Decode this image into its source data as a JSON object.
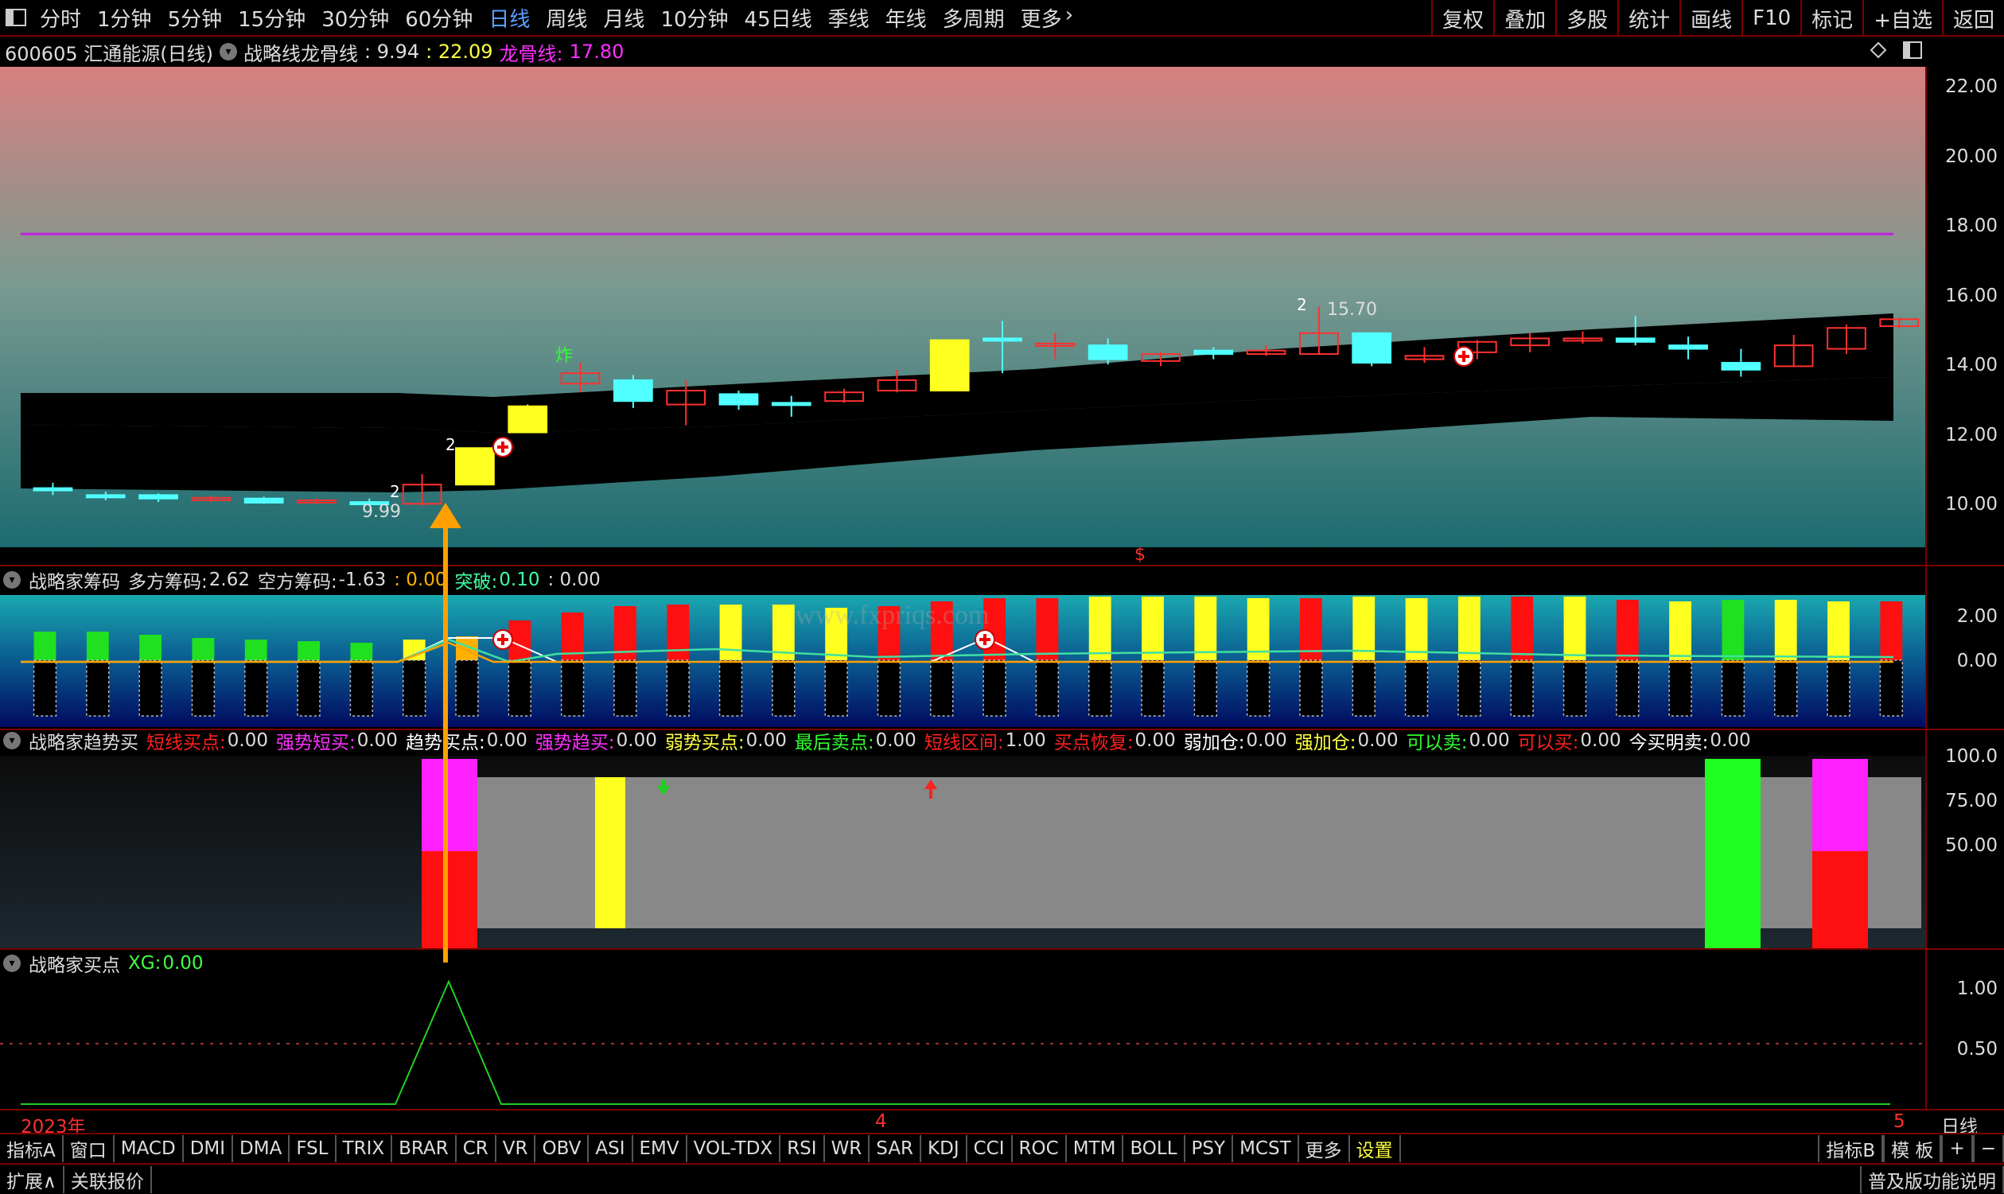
{
  "topbar": {
    "periods": [
      "分时",
      "1分钟",
      "5分钟",
      "15分钟",
      "30分钟",
      "60分钟",
      "日线",
      "周线",
      "月线",
      "10分钟",
      "45日线",
      "季线",
      "年线",
      "多周期",
      "更多"
    ],
    "active_index": 6,
    "right_tools": [
      "复权",
      "叠加",
      "多股",
      "统计",
      "画线",
      "F10",
      "标记",
      "+自选",
      "返回"
    ]
  },
  "main": {
    "stock": "600605 汇通能源(日线)",
    "indicator": "战略线龙骨线",
    "v1": ": 9.94",
    "v2": ": 22.09",
    "dragon_label": "龙骨线:",
    "dragon_value": "17.80",
    "axis": [
      "22.00",
      "20.00",
      "18.00",
      "16.00",
      "14.00",
      "12.00",
      "10.00"
    ],
    "annot_high": "15.70",
    "annot_low": "9.99",
    "annot_zha": "炸",
    "annot_2a": "2",
    "annot_2b": "2",
    "annot_2c": "2",
    "marker_s": "$"
  },
  "chip": {
    "name": "战略家筹码",
    "multi_label": "多方筹码:",
    "multi_value": "2.62",
    "empty_label": "空方筹码:",
    "empty_value": "-1.63",
    "zero_value": ": 0.00",
    "break_label": "突破:",
    "break_value": "0.10",
    "tail": ": 0.00",
    "axis": [
      "2.00",
      "0.00"
    ],
    "watermark": "www.fxpriqs.com"
  },
  "trend": {
    "name": "战略家趋势买",
    "items": [
      {
        "label": "短线买点:",
        "value": "0.00",
        "color": "#ff2020"
      },
      {
        "label": "强势短买:",
        "value": "0.00",
        "color": "#ff30ff"
      },
      {
        "label": "趋势买点:",
        "value": "0.00",
        "color": "#ffffff"
      },
      {
        "label": "强势趋买:",
        "value": "0.00",
        "color": "#ff30ff"
      },
      {
        "label": "弱势买点:",
        "value": "0.00",
        "color": "#ffff40"
      },
      {
        "label": "最后卖点:",
        "value": "0.00",
        "color": "#30ff30"
      },
      {
        "label": "短线区间:",
        "value": "1.00",
        "color": "#ff2020"
      },
      {
        "label": "买点恢复:",
        "value": "0.00",
        "color": "#ff2020"
      },
      {
        "label": "弱加仓:",
        "value": "0.00",
        "color": "#ffffff"
      },
      {
        "label": "强加仓:",
        "value": "0.00",
        "color": "#ffff40"
      },
      {
        "label": "可以卖:",
        "value": "0.00",
        "color": "#30ff30"
      },
      {
        "label": "可以买:",
        "value": "0.00",
        "color": "#ff2020"
      },
      {
        "label": "今买明卖:",
        "value": "0.00",
        "color": "#ffffff"
      }
    ],
    "axis": [
      "100.0",
      "75.00",
      "50.00"
    ]
  },
  "buy": {
    "name": "战略家买点",
    "xg_label": "XG:",
    "xg_value": "0.00",
    "axis": [
      "1.00",
      "0.50"
    ]
  },
  "timeline": {
    "year": "2023年",
    "m4": "4",
    "m5": "5",
    "period": "日线"
  },
  "bottom_tabs": [
    "指标A",
    "窗口",
    "MACD",
    "DMI",
    "DMA",
    "FSL",
    "TRIX",
    "BRAR",
    "CR",
    "VR",
    "OBV",
    "ASI",
    "EMV",
    "VOL-TDX",
    "RSI",
    "WR",
    "SAR",
    "KDJ",
    "CCI",
    "ROC",
    "MTM",
    "BOLL",
    "PSY",
    "MCST",
    "更多",
    "设置"
  ],
  "bottom_right": [
    "指标B",
    "模 板",
    "+",
    "−"
  ],
  "foot": {
    "left1": "扩展∧",
    "left2": "关联报价",
    "right": "普及版功能说明"
  },
  "chart_data": {
    "type": "candlestick",
    "ylim": [
      8.8,
      22.6
    ],
    "candles": [
      {
        "o": 10.5,
        "c": 10.5,
        "h": 10.65,
        "l": 10.3,
        "col": "#50ffff"
      },
      {
        "o": 10.3,
        "c": 10.25,
        "h": 10.4,
        "l": 10.15,
        "col": "#50ffff"
      },
      {
        "o": 10.3,
        "c": 10.2,
        "h": 10.35,
        "l": 10.1,
        "col": "#50ffff"
      },
      {
        "o": 10.18,
        "c": 10.22,
        "h": 10.28,
        "l": 10.1,
        "col": "#ff3030"
      },
      {
        "o": 10.2,
        "c": 10.08,
        "h": 10.25,
        "l": 10.05,
        "col": "#50ffff"
      },
      {
        "o": 10.12,
        "c": 10.15,
        "h": 10.2,
        "l": 10.05,
        "col": "#ff3030"
      },
      {
        "o": 10.1,
        "c": 10.05,
        "h": 10.2,
        "l": 9.99,
        "col": "#50ffff"
      },
      {
        "o": 10.05,
        "c": 10.6,
        "h": 10.9,
        "l": 9.99,
        "col": "#ff3030"
      },
      {
        "o": 10.6,
        "c": 11.65,
        "h": 11.65,
        "l": 10.6,
        "col": "#ffff20"
      },
      {
        "o": 12.1,
        "c": 12.85,
        "h": 12.9,
        "l": 12.1,
        "col": "#ffff20"
      },
      {
        "o": 13.5,
        "c": 13.8,
        "h": 14.1,
        "l": 13.25,
        "col": "#ff3030"
      },
      {
        "o": 13.6,
        "c": 13.0,
        "h": 13.75,
        "l": 12.8,
        "col": "#50ffff"
      },
      {
        "o": 12.9,
        "c": 13.3,
        "h": 13.6,
        "l": 12.3,
        "col": "#ff3030"
      },
      {
        "o": 13.2,
        "c": 12.9,
        "h": 13.3,
        "l": 12.75,
        "col": "#50ffff"
      },
      {
        "o": 12.95,
        "c": 12.9,
        "h": 13.15,
        "l": 12.55,
        "col": "#50ffff"
      },
      {
        "o": 13.0,
        "c": 13.25,
        "h": 13.35,
        "l": 12.95,
        "col": "#ff3030"
      },
      {
        "o": 13.3,
        "c": 13.6,
        "h": 13.9,
        "l": 13.25,
        "col": "#ff3030"
      },
      {
        "o": 13.3,
        "c": 14.75,
        "h": 14.75,
        "l": 13.3,
        "col": "#ffff20"
      },
      {
        "o": 14.8,
        "c": 14.75,
        "h": 15.3,
        "l": 13.8,
        "col": "#50ffff"
      },
      {
        "o": 14.6,
        "c": 14.65,
        "h": 14.95,
        "l": 14.2,
        "col": "#ff3030"
      },
      {
        "o": 14.6,
        "c": 14.2,
        "h": 14.8,
        "l": 14.05,
        "col": "#50ffff"
      },
      {
        "o": 14.15,
        "c": 14.35,
        "h": 14.4,
        "l": 14.0,
        "col": "#ff3030"
      },
      {
        "o": 14.45,
        "c": 14.35,
        "h": 14.55,
        "l": 14.2,
        "col": "#50ffff"
      },
      {
        "o": 14.35,
        "c": 14.45,
        "h": 14.6,
        "l": 14.3,
        "col": "#ff3030"
      },
      {
        "o": 14.35,
        "c": 14.95,
        "h": 15.7,
        "l": 14.35,
        "col": "#ff3030"
      },
      {
        "o": 14.95,
        "c": 14.1,
        "h": 14.95,
        "l": 14.0,
        "col": "#50ffff"
      },
      {
        "o": 14.2,
        "c": 14.3,
        "h": 14.55,
        "l": 14.1,
        "col": "#ff3030"
      },
      {
        "o": 14.4,
        "c": 14.7,
        "h": 14.75,
        "l": 14.2,
        "col": "#ff3030"
      },
      {
        "o": 14.6,
        "c": 14.8,
        "h": 14.95,
        "l": 14.4,
        "col": "#ff3030"
      },
      {
        "o": 14.75,
        "c": 14.8,
        "h": 15.0,
        "l": 14.65,
        "col": "#ff3030"
      },
      {
        "o": 14.8,
        "c": 14.7,
        "h": 15.45,
        "l": 14.6,
        "col": "#50ffff"
      },
      {
        "o": 14.6,
        "c": 14.5,
        "h": 14.85,
        "l": 14.2,
        "col": "#50ffff"
      },
      {
        "o": 14.1,
        "c": 13.9,
        "h": 14.5,
        "l": 13.7,
        "col": "#50ffff"
      },
      {
        "o": 14.0,
        "c": 14.6,
        "h": 14.9,
        "l": 14.0,
        "col": "#ff3030"
      },
      {
        "o": 14.5,
        "c": 15.1,
        "h": 15.2,
        "l": 14.35,
        "col": "#ff3030"
      },
      {
        "o": 15.15,
        "c": 15.35,
        "h": 15.4,
        "l": 15.1,
        "col": "#ff3030"
      }
    ],
    "dragon_line": 17.8
  }
}
